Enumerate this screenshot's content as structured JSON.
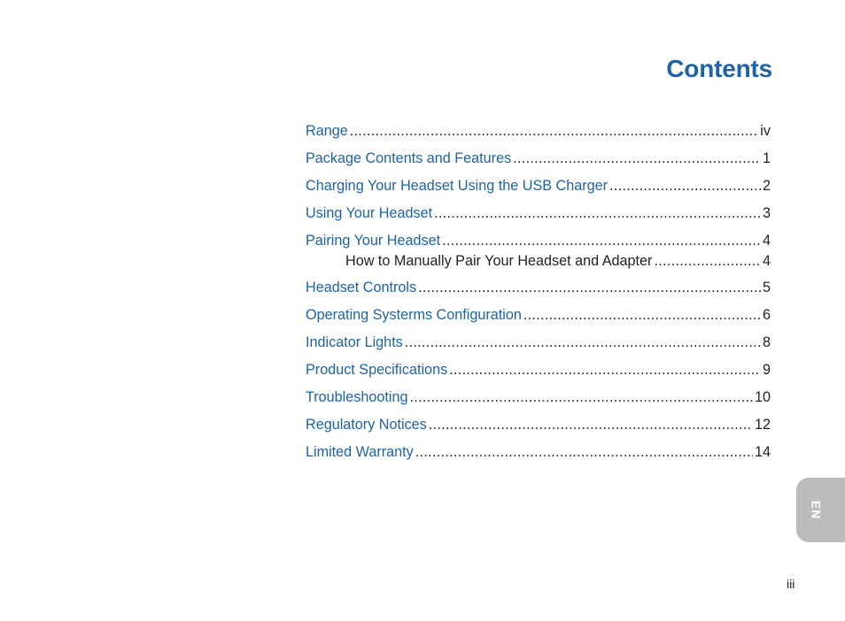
{
  "title": "Contents",
  "toc": [
    {
      "label": "Range",
      "page": "iv"
    },
    {
      "label": "Package Contents and Features",
      "page": "1"
    },
    {
      "label": "Charging Your Headset Using the USB Charger",
      "page": "2"
    },
    {
      "label": "Using Your Headset",
      "page": "3"
    },
    {
      "label": "Pairing Your Headset",
      "page": "4"
    },
    {
      "label": "How to Manually Pair Your Headset and Adapter",
      "page": "4",
      "sub": true
    },
    {
      "label": "Headset Controls",
      "page": "5"
    },
    {
      "label": "Operating Systerms Configuration",
      "page": "6"
    },
    {
      "label": "Indicator Lights",
      "page": "8"
    },
    {
      "label": "Product Specifications",
      "page": "9"
    },
    {
      "label": "Troubleshooting",
      "page": "10"
    },
    {
      "label": "Regulatory Notices",
      "page": "12"
    },
    {
      "label": "Limited Warranty",
      "page": "14"
    }
  ],
  "language_tab": "EN",
  "page_number": "iii",
  "colors": {
    "heading_blue": "#1d63a5",
    "body_text": "#231f20",
    "tab_gray": "#bcbcbc"
  }
}
